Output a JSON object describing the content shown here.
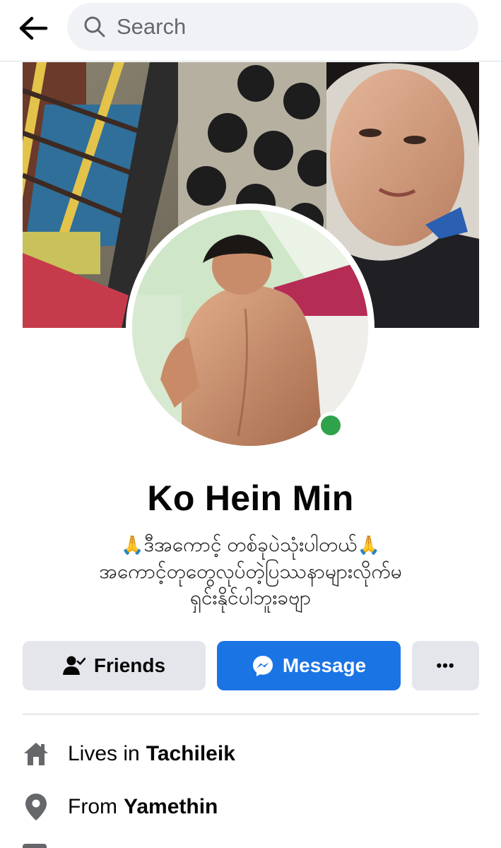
{
  "search": {
    "placeholder": "Search"
  },
  "profile": {
    "name": "Ko Hein Min",
    "bio_line1": "ဒီအကောင့် တစ်ခုပဲသုံးပါတယ်",
    "bio_line2": "အကောင့်တုတွေလုပ်တဲ့ပြဿနာများလိုက်မ",
    "bio_line3": "ရှင်းနိုင်ပါဘူးခဗျာ",
    "bio_emoji": "🙏"
  },
  "actions": {
    "friends_label": "Friends",
    "message_label": "Message",
    "more_label": "•••"
  },
  "info": {
    "lives_prefix": "Lives in",
    "lives_value": "Tachileik",
    "from_prefix": "From",
    "from_value": "Yamethin"
  },
  "colors": {
    "primary": "#1b74e4",
    "online": "#31a24c",
    "button_gray": "#e4e6eb",
    "icon_gray": "#65676b"
  },
  "icons": [
    "back-arrow-icon",
    "search-icon",
    "friends-check-icon",
    "messenger-icon",
    "more-dots-icon",
    "home-icon",
    "location-pin-icon"
  ]
}
